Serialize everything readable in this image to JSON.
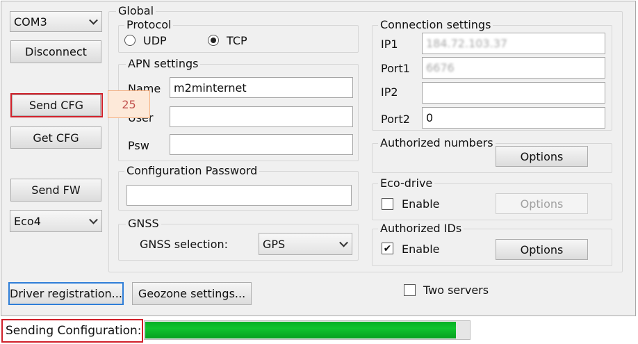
{
  "left_column": {
    "port_select": "COM3",
    "disconnect_label": "Disconnect",
    "send_cfg_label": "Send CFG",
    "get_cfg_label": "Get CFG",
    "send_fw_label": "Send FW",
    "device_select": "Eco4"
  },
  "global": {
    "title": "Global",
    "protocol": {
      "title": "Protocol",
      "udp_label": "UDP",
      "tcp_label": "TCP",
      "selected": "TCP"
    },
    "apn": {
      "title": "APN settings",
      "name_label": "Name",
      "name_value": "m2minternet",
      "user_label": "User",
      "user_value": "",
      "psw_label": "Psw",
      "psw_value": ""
    },
    "config_password": {
      "title": "Configuration Password",
      "value": ""
    },
    "gnss": {
      "title": "GNSS",
      "selection_label": "GNSS selection:",
      "selection_value": "GPS"
    },
    "connection": {
      "title": "Connection settings",
      "ip1_label": "IP1",
      "ip1_value": "184.72.103.37",
      "port1_label": "Port1",
      "port1_value": "6676",
      "ip2_label": "IP2",
      "ip2_value": "",
      "port2_label": "Port2",
      "port2_value": "0"
    },
    "authorized_numbers": {
      "title": "Authorized numbers",
      "options_label": "Options"
    },
    "eco_drive": {
      "title": "Eco-drive",
      "enable_label": "Enable",
      "enabled": false,
      "options_label": "Options"
    },
    "authorized_ids": {
      "title": "Authorized IDs",
      "enable_label": "Enable",
      "enabled": true,
      "options_label": "Options"
    }
  },
  "bottom": {
    "driver_registration_label": "Driver registration...",
    "geozone_settings_label": "Geozone settings...",
    "two_servers_label": "Two servers",
    "two_servers_checked": false
  },
  "status": {
    "sending_label": "Sending Configuration:",
    "progress": 0.96
  },
  "callout": {
    "value": "25"
  },
  "colors": {
    "highlight": "#d0202a",
    "progress_green": "#06b025",
    "callout_bg": "#fde9d9"
  }
}
